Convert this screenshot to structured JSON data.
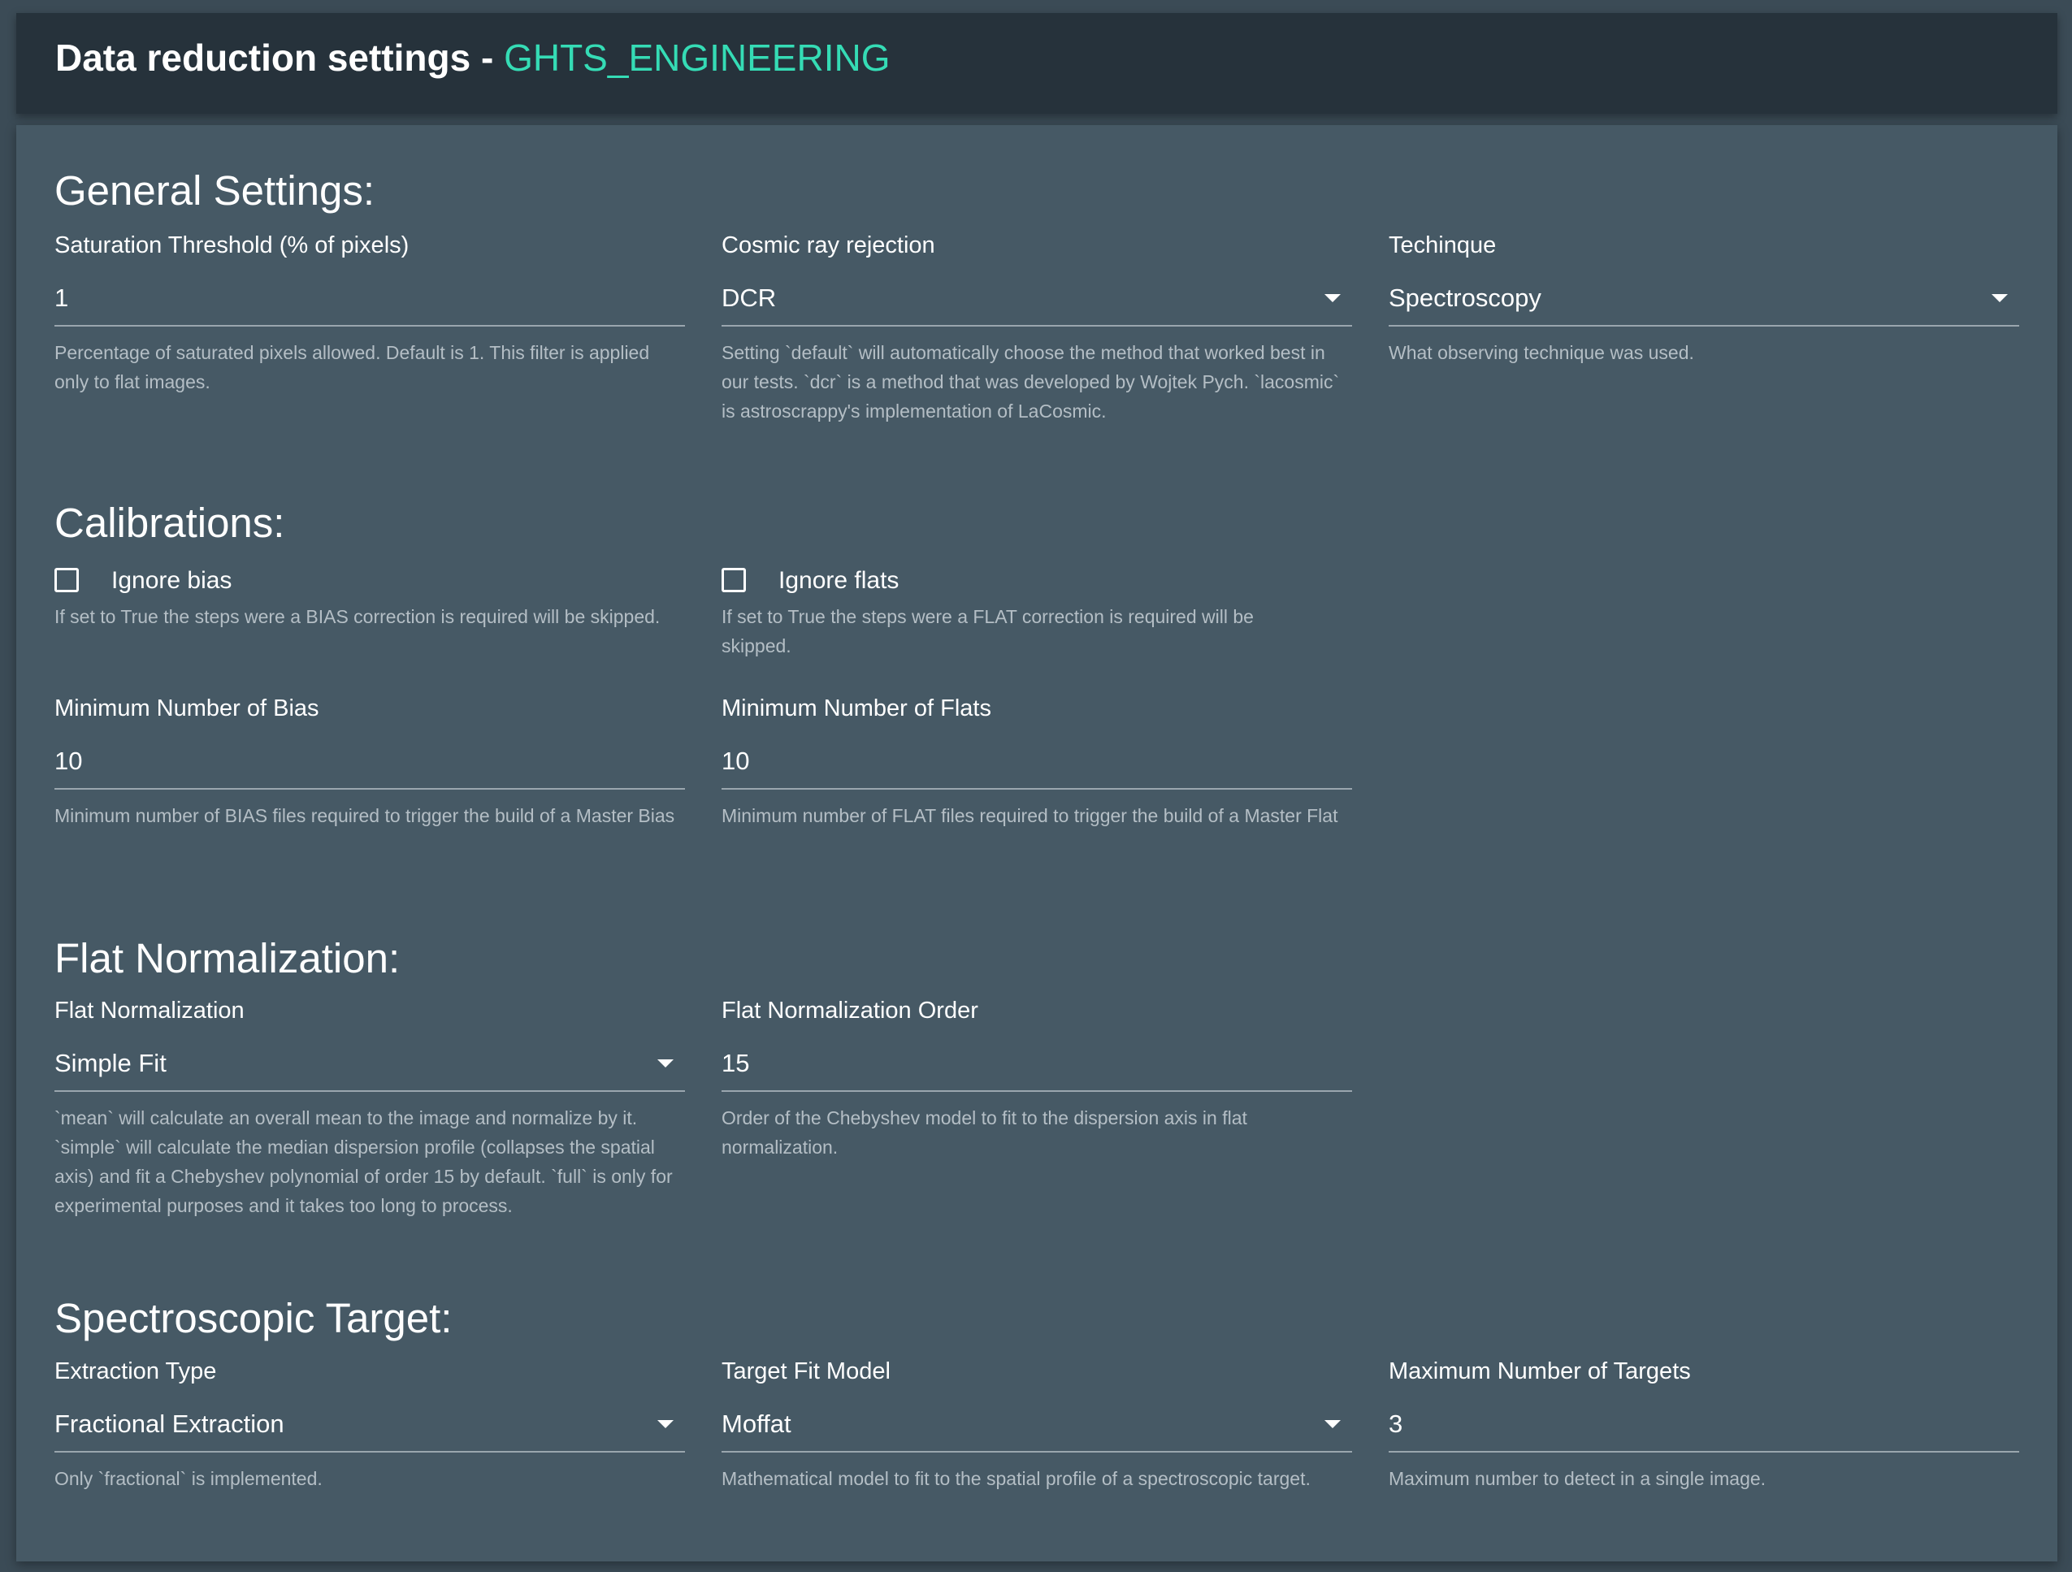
{
  "header": {
    "title": "Data reduction settings - ",
    "environment": "GHTS_ENGINEERING"
  },
  "general": {
    "title": "General Settings:",
    "saturation": {
      "label": "Saturation Threshold (% of pixels)",
      "value": "1",
      "help": "Percentage of saturated pixels allowed. Default is 1. This filter is applied only to flat images."
    },
    "cosmic": {
      "label": "Cosmic ray rejection",
      "value": "DCR",
      "help": "Setting `default` will automatically choose the method that worked best in our tests. `dcr` is a method that was developed by Wojtek Pych. `lacosmic` is astroscrappy's implementation of LaCosmic."
    },
    "technique": {
      "label": "Techinque",
      "value": "Spectroscopy",
      "help": "What observing technique was used."
    }
  },
  "calibrations": {
    "title": "Calibrations:",
    "ignore_bias": {
      "label": "Ignore bias",
      "checked": false,
      "help": "If set to True the steps were a BIAS correction is required will be skipped."
    },
    "ignore_flats": {
      "label": "Ignore flats",
      "checked": false,
      "help": "If set to True the steps were a FLAT correction is required will be skipped."
    },
    "min_bias": {
      "label": "Minimum Number of Bias",
      "value": "10",
      "help": "Minimum number of BIAS files required to trigger the build of a Master Bias"
    },
    "min_flats": {
      "label": "Minimum Number of Flats",
      "value": "10",
      "help": "Minimum number of FLAT files required to trigger the build of a Master Flat"
    }
  },
  "flat_norm": {
    "title": "Flat Normalization:",
    "method": {
      "label": "Flat Normalization",
      "value": "Simple Fit",
      "help": "`mean` will calculate an overall mean to the image and normalize by it. `simple` will calculate the median dispersion profile (collapses the spatial axis) and fit a Chebyshev polynomial of order 15 by default. `full` is only for experimental purposes and it takes too long to process."
    },
    "order": {
      "label": "Flat Normalization Order",
      "value": "15",
      "help": "Order of the Chebyshev model to fit to the dispersion axis in flat normalization."
    }
  },
  "target": {
    "title": "Spectroscopic Target:",
    "extraction": {
      "label": "Extraction Type",
      "value": "Fractional Extraction",
      "help": "Only `fractional` is implemented."
    },
    "fit_model": {
      "label": "Target Fit Model",
      "value": "Moffat",
      "help": "Mathematical model to fit to the spatial profile of a spectroscopic target."
    },
    "max_targets": {
      "label": "Maximum Number of Targets",
      "value": "3",
      "help": "Maximum number to detect in a single image."
    }
  },
  "colors": {
    "header_bg": "#26323b",
    "panel_bg": "#465965",
    "page_bg": "#3b4b56",
    "accent": "#35dcb5"
  }
}
